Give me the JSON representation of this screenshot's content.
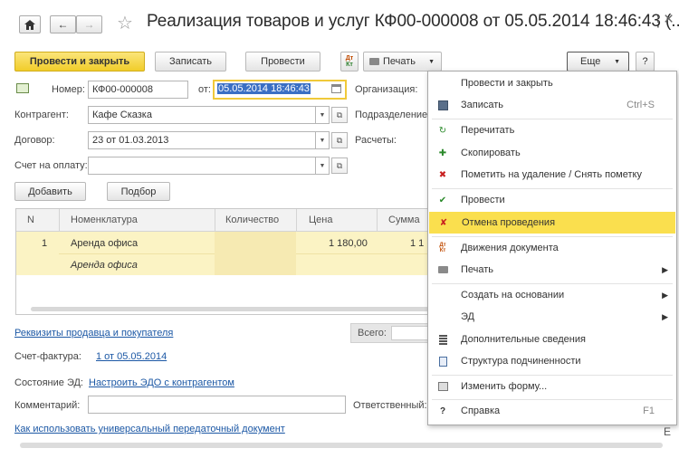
{
  "header": {
    "title": "Реализация товаров и услуг КФ00-000008 от 05.05.2014 18:46:43 (...",
    "more_dots": "⋮",
    "close": "×"
  },
  "toolbar": {
    "post_close": "Провести и закрыть",
    "save": "Записать",
    "post": "Провести",
    "print": "Печать",
    "more": "Еще",
    "help": "?"
  },
  "form": {
    "number_label": "Номер:",
    "number_value": "КФ00-000008",
    "date_label": "от:",
    "date_value": "05.05.2014 18:46:43",
    "org_label": "Организация:",
    "counterparty_label": "Контрагент:",
    "counterparty_value": "Кафе Сказка",
    "division_label": "Подразделение:",
    "contract_label": "Договор:",
    "contract_value": "23  от 01.03.2013",
    "settlements_label": "Расчеты:",
    "invoice_label": "Счет на оплату:",
    "invoice_value": ""
  },
  "table_toolbar": {
    "add": "Добавить",
    "pick": "Подбор"
  },
  "table": {
    "columns": [
      "N",
      "Номенклатура",
      "Количество",
      "Цена",
      "Сумма"
    ],
    "rows": [
      {
        "n": "1",
        "item": "Аренда офиса",
        "item_detail": "Аренда офиса",
        "qty": "",
        "price": "1 180,00",
        "sum": "1 1"
      }
    ]
  },
  "footer": {
    "requisites_link": "Реквизиты продавца и покупателя",
    "total_label": "Всего:",
    "invoice_doc_label": "Счет-фактура:",
    "invoice_doc_link": "1 от 05.05.2014",
    "edo_label": "Состояние ЭД:",
    "edo_link": "Настроить ЭДО с контрагентом",
    "comment_label": "Комментарий:",
    "comment_value": "",
    "responsible_label": "Ответственный:",
    "upd_link": "Как использовать универсальный передаточный документ",
    "edge_char": "Е"
  },
  "menu": {
    "items": [
      {
        "label": "Провести и закрыть",
        "icon": "none-icon",
        "shortcut": ""
      },
      {
        "label": "Записать",
        "icon": "save-icon",
        "shortcut": "Ctrl+S"
      },
      {
        "label": "Перечитать",
        "icon": "reread-icon",
        "shortcut": ""
      },
      {
        "label": "Скопировать",
        "icon": "copy-icon",
        "shortcut": ""
      },
      {
        "label": "Пометить на удаление / Снять пометку",
        "icon": "delete-mark-icon",
        "shortcut": ""
      },
      {
        "label": "Провести",
        "icon": "post-icon",
        "shortcut": ""
      },
      {
        "label": "Отмена проведения",
        "icon": "unpost-icon",
        "shortcut": ""
      },
      {
        "label": "Движения документа",
        "icon": "movements-icon",
        "shortcut": ""
      },
      {
        "label": "Печать",
        "icon": "printer-icon",
        "shortcut": ""
      },
      {
        "label": "Создать на основании",
        "icon": "none-icon",
        "shortcut": ""
      },
      {
        "label": "ЭД",
        "icon": "none-icon",
        "shortcut": ""
      },
      {
        "label": "Дополнительные сведения",
        "icon": "details-icon",
        "shortcut": ""
      },
      {
        "label": "Структура подчиненности",
        "icon": "structure-icon",
        "shortcut": ""
      },
      {
        "label": "Изменить форму...",
        "icon": "form-icon",
        "shortcut": ""
      },
      {
        "label": "Справка",
        "icon": "help-icon",
        "shortcut": "F1"
      }
    ],
    "highlighted_index": 6
  },
  "colors": {
    "primary_button": "#f5d33b",
    "highlight": "#fadf4e",
    "link": "#1c58a5",
    "selected_row": "#fbf3c4"
  }
}
